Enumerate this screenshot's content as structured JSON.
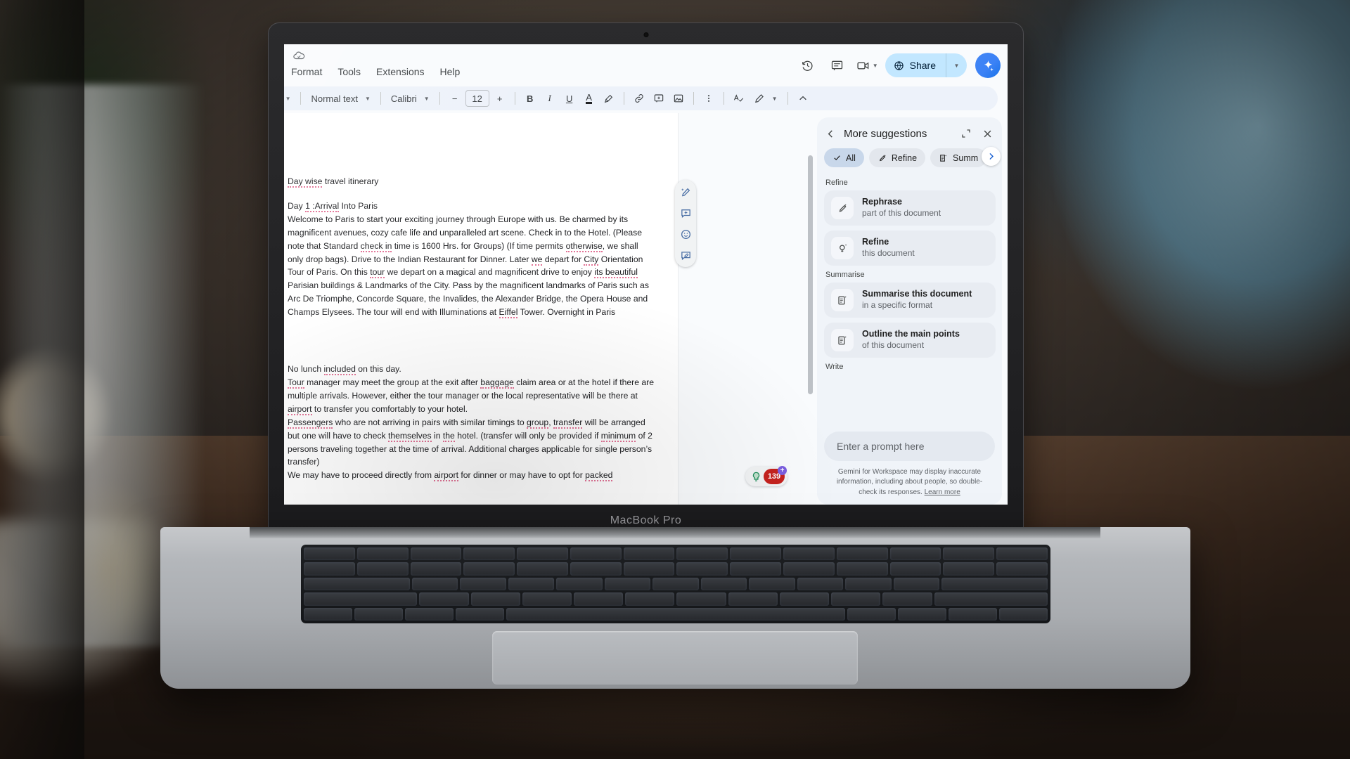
{
  "device": {
    "label": "MacBook Pro"
  },
  "docs": {
    "menus": [
      "Format",
      "Tools",
      "Extensions",
      "Help"
    ],
    "cloud_icon": "cloud-saved-icon",
    "top_right": {
      "history_icon": "version-history-icon",
      "comments_icon": "comment-icon",
      "meet_icon": "video-camera-icon",
      "meet_caret": "chevron-down-icon",
      "share_label": "Share",
      "share_globe_icon": "globe-icon",
      "share_caret": "chevron-down-icon",
      "gemini_icon": "gemini-spark-icon"
    },
    "toolbar": {
      "zoom_value": "%",
      "style_value": "Normal text",
      "font_value": "Calibri",
      "font_decrease": "−",
      "font_size": "12",
      "font_increase": "+",
      "bold": "B",
      "italic": "I",
      "underline": "U",
      "text_color": "A",
      "highlight_icon": "highlighter-icon",
      "link_icon": "insert-link-icon",
      "comment_icon": "add-comment-icon",
      "image_icon": "insert-image-icon",
      "more_icon": "more-vertical-icon",
      "spellcheck_icon": "spellcheck-icon",
      "editing_mode_icon": "pencil-edit-icon",
      "editing_caret": "chevron-down-icon",
      "collapse_icon": "chevron-up-icon"
    },
    "floating_tools": [
      {
        "icon": "magic-pen-icon",
        "name": "help-me-write"
      },
      {
        "icon": "add-comment-icon",
        "name": "add-comment"
      },
      {
        "icon": "emoji-reaction-icon",
        "name": "add-emoji-reaction"
      },
      {
        "icon": "suggest-edit-icon",
        "name": "suggest-edits"
      }
    ],
    "badge": {
      "explore_icon": "explore-bulb-icon",
      "count": "139",
      "plus": "+"
    },
    "document": {
      "title_line": "Day wise travel itinerary",
      "paragraphs": [
        {
          "id": "day1-heading",
          "runs": [
            {
              "t": "Day ",
              "sp": false
            },
            {
              "t": "1 :Arrival",
              "sp": true
            },
            {
              "t": " Into Paris",
              "sp": false
            }
          ]
        },
        {
          "id": "day1-body",
          "runs": [
            {
              "t": "Welcome to Paris to start your exciting journey through Europe with us. Be charmed by its magnificent avenues, cozy cafe life and unparalleled art scene. Check in to the Hotel. (Please note that Standard ",
              "sp": false
            },
            {
              "t": "check in",
              "sp": true
            },
            {
              "t": " time is 1600 Hrs. for Groups) (If time permits ",
              "sp": false
            },
            {
              "t": "otherwise",
              "sp": true
            },
            {
              "t": ", we shall only drop bags). Drive to the Indian Restaurant for Dinner. Later ",
              "sp": false
            },
            {
              "t": "we",
              "sp": true
            },
            {
              "t": " depart for ",
              "sp": false
            },
            {
              "t": "City",
              "sp": true
            },
            {
              "t": " Orientation Tour of Paris. On this ",
              "sp": false
            },
            {
              "t": "tour",
              "sp": true
            },
            {
              "t": " we depart on a magical and magnificent drive to enjoy ",
              "sp": false
            },
            {
              "t": "its beautiful",
              "sp": true
            },
            {
              "t": " Parisian buildings & Landmarks of the City. Pass by the magnificent landmarks of Paris such as Arc De Triomphe, Concorde Square, the Invalides, the Alexander Bridge, the Opera House and Champs Elysees. The tour will end with Illuminations at ",
              "sp": false
            },
            {
              "t": "Eiffel",
              "sp": true
            },
            {
              "t": " Tower. Overnight in Paris",
              "sp": false
            }
          ]
        },
        {
          "id": "no-lunch",
          "runs": [
            {
              "t": "No lunch ",
              "sp": false
            },
            {
              "t": "included",
              "sp": true
            },
            {
              "t": " on this day.",
              "sp": false
            }
          ]
        },
        {
          "id": "tour-manager",
          "runs": [
            {
              "t": "Tour",
              "sp": true
            },
            {
              "t": " manager may meet the group at the exit after ",
              "sp": false
            },
            {
              "t": "baggage",
              "sp": true
            },
            {
              "t": " claim area or at the hotel if there are multiple arrivals. However, either the tour manager or the local representative will be there at ",
              "sp": false
            },
            {
              "t": "airport",
              "sp": true
            },
            {
              "t": " to transfer you comfortably to your hotel.",
              "sp": false
            }
          ]
        },
        {
          "id": "passengers",
          "runs": [
            {
              "t": "Passengers",
              "sp": true
            },
            {
              "t": " who are not arriving in pairs with similar timings to ",
              "sp": false
            },
            {
              "t": "group",
              "sp": true
            },
            {
              "t": ", ",
              "sp": false
            },
            {
              "t": "transfer",
              "sp": true
            },
            {
              "t": " will be arranged but one will have to check ",
              "sp": false
            },
            {
              "t": "themselves",
              "sp": true
            },
            {
              "t": " in ",
              "sp": false
            },
            {
              "t": "the",
              "sp": true
            },
            {
              "t": " hotel. (transfer will only be provided if ",
              "sp": false
            },
            {
              "t": "minimum",
              "sp": true
            },
            {
              "t": " of 2 persons traveling together at the time of arrival. Additional charges applicable for single person’s transfer)",
              "sp": false
            }
          ]
        },
        {
          "id": "proceed",
          "runs": [
            {
              "t": "We may have to proceed directly from ",
              "sp": false
            },
            {
              "t": "airport",
              "sp": true
            },
            {
              "t": " for dinner or may have to opt for ",
              "sp": false
            },
            {
              "t": "packed",
              "sp": true
            }
          ]
        }
      ]
    }
  },
  "side_panel": {
    "back_icon": "chevron-left-icon",
    "title": "More suggestions",
    "expand_icon": "expand-panel-icon",
    "close_icon": "close-icon",
    "chips": [
      {
        "label": "All",
        "icon": "check-icon",
        "active": true
      },
      {
        "label": "Refine",
        "icon": "refine-icon",
        "active": false
      },
      {
        "label": "Summ",
        "icon": "summarise-icon",
        "active": false
      }
    ],
    "chip_next_icon": "chevron-right-icon",
    "groups": [
      {
        "label": "Refine",
        "items": [
          {
            "title": "Rephrase",
            "subtitle": "part of this document",
            "icon": "magic-pen-icon"
          },
          {
            "title": "Refine",
            "subtitle": "this document",
            "icon": "refine-bulb-icon"
          }
        ]
      },
      {
        "label": "Summarise",
        "items": [
          {
            "title": "Summarise this document",
            "subtitle": "in a specific format",
            "icon": "summarise-icon"
          },
          {
            "title": "Outline the main points",
            "subtitle": "of this document",
            "icon": "summarise-icon"
          }
        ]
      },
      {
        "label": "Write",
        "items": []
      }
    ],
    "prompt_placeholder": "Enter a prompt here",
    "disclaimer": "Gemini for Workspace may display inaccurate information, including about people, so double-check its responses.",
    "disclaimer_link": "Learn more"
  },
  "colors": {
    "accent_blue": "#0b57d0",
    "share_bg": "#c2e7ff",
    "panel_bg": "#f0f4f9",
    "badge_red": "#c5221f",
    "spellcheck_pink": "#e27396"
  }
}
